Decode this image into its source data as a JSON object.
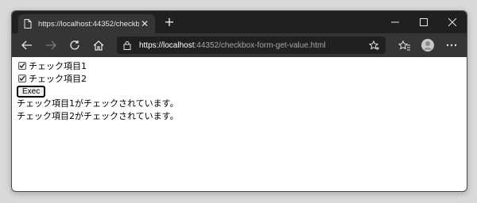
{
  "browser": {
    "tab_title": "https://localhost:44352/checkbo",
    "new_tab_symbol": "+",
    "address_host": "https://localhost",
    "address_rest": ":44352/checkbox-form-get-value.html"
  },
  "page": {
    "checkboxes": [
      {
        "label": "チェック項目1",
        "checked": true
      },
      {
        "label": "チェック項目2",
        "checked": true
      }
    ],
    "exec_label": "Exec",
    "messages": [
      "チェック項目1がチェックされています。",
      "チェック項目2がチェックされています。"
    ]
  },
  "colors": {
    "titlebar": "#202020",
    "toolbar": "#353535",
    "addressbar": "#202020"
  }
}
